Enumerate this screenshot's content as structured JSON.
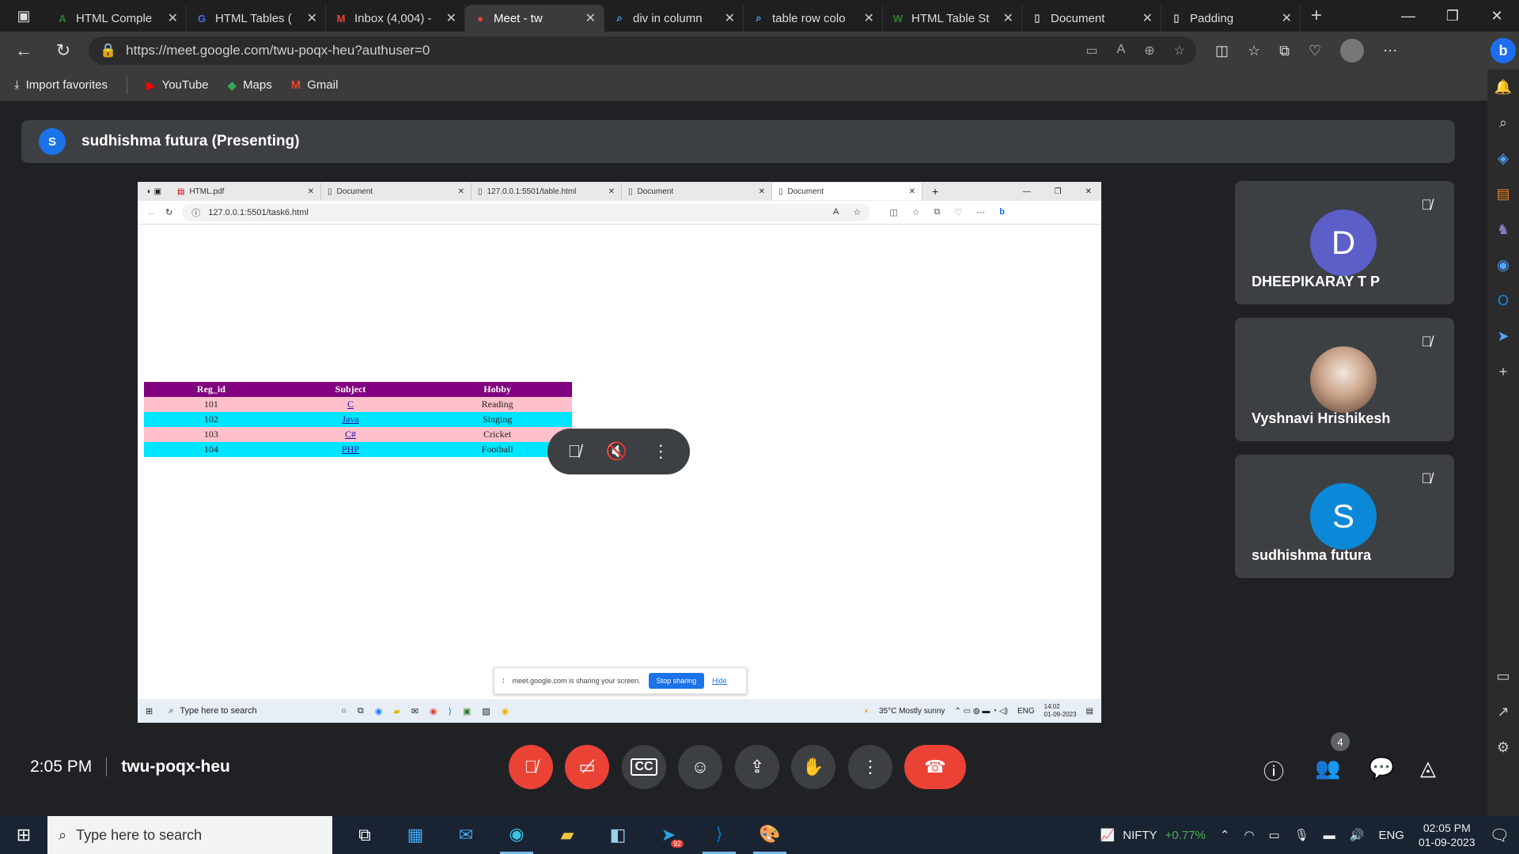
{
  "browser": {
    "tabs": [
      {
        "label": "HTML Comple",
        "icon": "A",
        "icon_color": "#2e7d32"
      },
      {
        "label": "HTML Tables (",
        "icon": "G",
        "icon_color": "#4a6cf7"
      },
      {
        "label": "Inbox (4,004) -",
        "icon": "M",
        "icon_color": "#ea4335"
      },
      {
        "label": "Meet - tw",
        "icon": "●",
        "icon_color": "#ea4335"
      },
      {
        "label": "div in column",
        "icon": "Q",
        "icon_color": "#4fa3ff"
      },
      {
        "label": "table row colo",
        "icon": "Q",
        "icon_color": "#4fa3ff"
      },
      {
        "label": "HTML Table St",
        "icon": "W",
        "icon_color": "#2e7d32"
      },
      {
        "label": "Document",
        "icon": "▯",
        "icon_color": "#cccccc"
      },
      {
        "label": "Padding",
        "icon": "▯",
        "icon_color": "#cccccc"
      }
    ],
    "url": "https://meet.google.com/twu-poqx-heu?authuser=0",
    "favorites": [
      {
        "label": "Import favorites"
      },
      {
        "label": "YouTube"
      },
      {
        "label": "Maps"
      },
      {
        "label": "Gmail"
      }
    ]
  },
  "meet": {
    "presenter": {
      "initial": "S",
      "label": "sudhishma futura (Presenting)"
    },
    "participants": [
      {
        "name": "DHEEPIKARAY T P",
        "initial": "D",
        "color": "#5b5fc7"
      },
      {
        "name": "Vyshnavi Hrishikesh",
        "initial": "",
        "color": "#c9a38a"
      },
      {
        "name": "sudhishma futura",
        "initial": "S",
        "color": "#0b88d8"
      }
    ],
    "time": "2:05 PM",
    "code": "twu-poqx-heu",
    "people_count": "4"
  },
  "shared_screen": {
    "tabs": [
      {
        "label": "HTML.pdf"
      },
      {
        "label": "Document"
      },
      {
        "label": "127.0.0.1:5501/table.html"
      },
      {
        "label": "Document"
      },
      {
        "label": "Document"
      }
    ],
    "url": "127.0.0.1:5501/task6.html",
    "table": {
      "headers": [
        "Reg_id",
        "Subject",
        "Hobby"
      ],
      "rows": [
        [
          "101",
          "C",
          "Reading"
        ],
        [
          "102",
          "Java",
          "Singing"
        ],
        [
          "103",
          "C#",
          "Cricket"
        ],
        [
          "104",
          "PHP",
          "Football"
        ]
      ]
    },
    "notice": {
      "text": "meet.google.com is sharing your screen.",
      "stop": "Stop sharing",
      "hide": "Hide"
    },
    "taskbar": {
      "search": "Type here to search",
      "weather": "35°C  Mostly sunny",
      "lang": "ENG",
      "time": "14:02",
      "date": "01-09-2023"
    }
  },
  "taskbar": {
    "search_placeholder": "Type here to search",
    "nifty_label": "NIFTY",
    "nifty_change": "+0.77%",
    "lang": "ENG",
    "time": "02:05 PM",
    "date": "01-09-2023",
    "telegram_badge": "92"
  }
}
